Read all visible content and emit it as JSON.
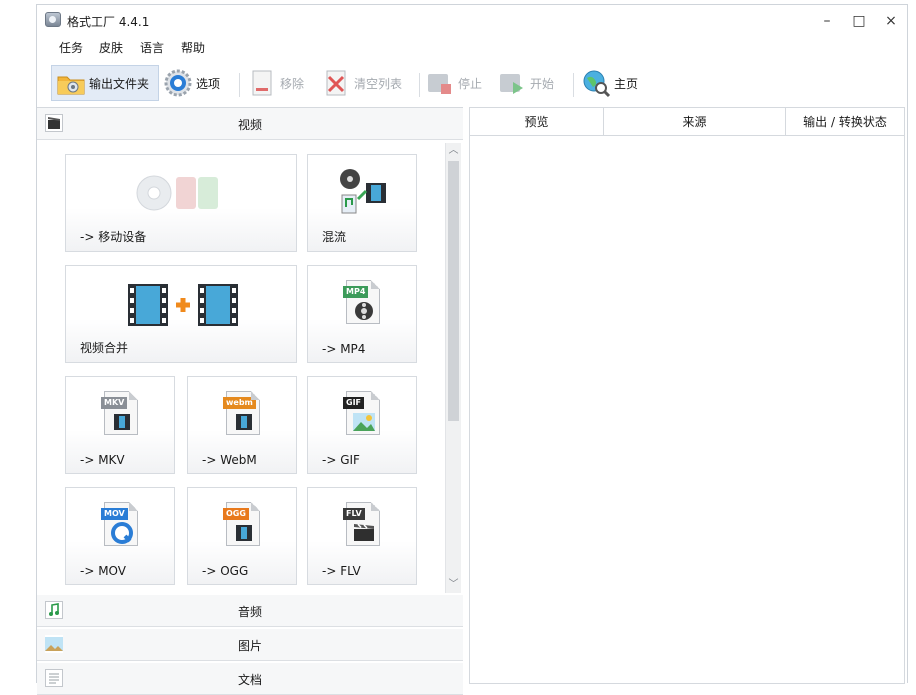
{
  "window": {
    "title": "格式工厂 4.4.1",
    "controls": {
      "minimize": "–",
      "maximize": "□",
      "close": "×"
    }
  },
  "menu": {
    "items": [
      "任务",
      "皮肤",
      "语言",
      "帮助"
    ]
  },
  "toolbar": {
    "output_folder": "输出文件夹",
    "options": "选项",
    "remove": "移除",
    "clear_list": "清空列表",
    "stop": "停止",
    "start": "开始",
    "home": "主页"
  },
  "categories": {
    "video": "视频",
    "audio": "音频",
    "image": "图片",
    "document": "文档"
  },
  "video_tiles": [
    {
      "label": "-> 移动设备",
      "icon": "mobile-device-icon"
    },
    {
      "label": "混流",
      "icon": "mux-icon"
    },
    {
      "label": "视频合并",
      "icon": "video-join-icon"
    },
    {
      "label": "-> MP4",
      "icon": "mp4-file-icon",
      "tag": "MP4"
    },
    {
      "label": "-> MKV",
      "icon": "mkv-file-icon",
      "tag": "MKV"
    },
    {
      "label": "-> WebM",
      "icon": "webm-file-icon",
      "tag": "webm"
    },
    {
      "label": "-> GIF",
      "icon": "gif-file-icon",
      "tag": "GIF"
    },
    {
      "label": "-> MOV",
      "icon": "mov-file-icon",
      "tag": "MOV"
    },
    {
      "label": "-> OGG",
      "icon": "ogg-file-icon",
      "tag": "OGG"
    },
    {
      "label": "-> FLV",
      "icon": "flv-file-icon",
      "tag": "FLV"
    }
  ],
  "task_table": {
    "columns": [
      "预览",
      "来源",
      "输出 / 转换状态"
    ]
  },
  "colors": {
    "accent": "#2a7dd6",
    "mp4_tag": "#3c9b5a",
    "mkv_tag": "#8a8f96",
    "webm_tag": "#e58a1f",
    "gif_tag": "#222222",
    "mov_tag": "#2a7dd6",
    "ogg_tag": "#e8791c",
    "flv_tag": "#3a3a3a"
  }
}
